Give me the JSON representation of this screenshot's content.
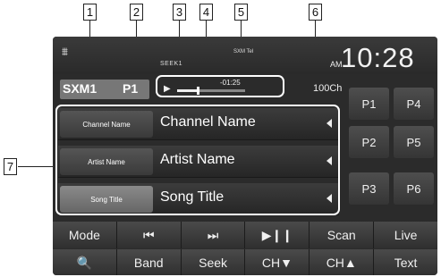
{
  "callouts": [
    "1",
    "2",
    "3",
    "4",
    "5",
    "6",
    "7"
  ],
  "status": {
    "seek_label": "SEEK1",
    "signal_label": "SXM Tel",
    "ampm": "AM",
    "clock": "10:28"
  },
  "source": {
    "name": "SXM1",
    "preset": "P1"
  },
  "playback": {
    "elapsed": "-01:25",
    "progress_fraction": 0.3,
    "channel_count": "100Ch"
  },
  "info_rows": [
    {
      "tag": "Channel Name",
      "value": "Channel Name",
      "active": false
    },
    {
      "tag": "Artist Name",
      "value": "Artist Name",
      "active": false
    },
    {
      "tag": "Song Title",
      "value": "Song Title",
      "active": true
    }
  ],
  "presets": [
    "P1",
    "P4",
    "P2",
    "P5",
    "P3",
    "P6"
  ],
  "controls_row1": [
    "Mode",
    "⏮",
    "⏭",
    "▶❙❙",
    "Scan",
    "Live"
  ],
  "controls_row2": [
    "🔍",
    "Band",
    "Seek",
    "CH▼",
    "CH▲",
    "Text"
  ]
}
